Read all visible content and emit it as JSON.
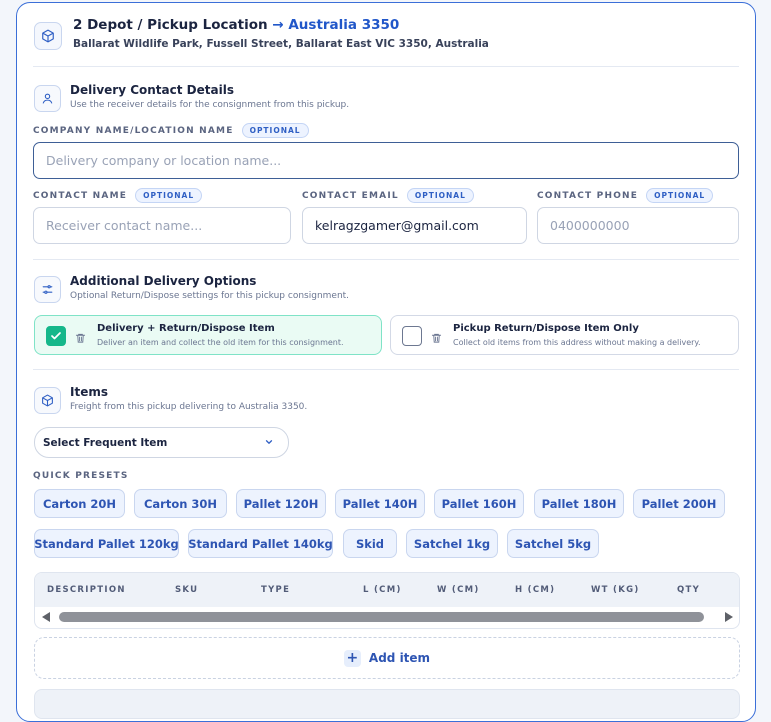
{
  "header": {
    "title": "2 Depot / Pickup Location",
    "arrow": "→",
    "destination": "Australia 3350",
    "address": "Ballarat Wildlife Park, Fussell Street, Ballarat East VIC 3350, Australia",
    "icon": "box-icon"
  },
  "contact": {
    "title": "Delivery Contact Details",
    "subtitle": "Use the receiver details for the consignment from this pickup.",
    "icon": "user-icon",
    "optional_badge": "OPTIONAL",
    "company": {
      "label": "COMPANY NAME/LOCATION NAME",
      "placeholder": "Delivery company or location name...",
      "value": ""
    },
    "name": {
      "label": "CONTACT NAME",
      "placeholder": "Receiver contact name...",
      "value": ""
    },
    "email": {
      "label": "CONTACT EMAIL",
      "placeholder": "",
      "value": "kelragzgamer@gmail.com"
    },
    "phone": {
      "label": "CONTACT PHONE",
      "placeholder": "0400000000",
      "value": ""
    }
  },
  "options": {
    "title": "Additional Delivery Options",
    "subtitle": "Optional Return/Dispose settings for this pickup consignment.",
    "icon": "sliders-icon",
    "items": [
      {
        "title": "Delivery + Return/Dispose Item",
        "desc": "Deliver an item and collect the old item for this consignment.",
        "checked": true
      },
      {
        "title": "Pickup Return/Dispose Item Only",
        "desc": "Collect old items from this address without making a delivery.",
        "checked": false
      }
    ]
  },
  "items": {
    "title": "Items",
    "subtitle": "Freight from this pickup delivering to Australia 3350.",
    "icon": "box-icon",
    "select_label": "Select Frequent Item",
    "presets_label": "QUICK PRESETS",
    "presets": [
      "Carton 20H",
      "Carton 30H",
      "Pallet 120H",
      "Pallet 140H",
      "Pallet 160H",
      "Pallet 180H",
      "Pallet 200H",
      "Standard Pallet 120kg",
      "Standard Pallet 140kg",
      "Skid",
      "Satchel 1kg",
      "Satchel 5kg"
    ],
    "columns": [
      "DESCRIPTION",
      "SKU",
      "TYPE",
      "L (CM)",
      "W (CM)",
      "H (CM)",
      "WT (KG)",
      "QTY"
    ],
    "add_label": "Add item"
  },
  "colors": {
    "accent": "#2157c9",
    "success": "#16b78a",
    "chip_bg": "#edf3fe"
  }
}
